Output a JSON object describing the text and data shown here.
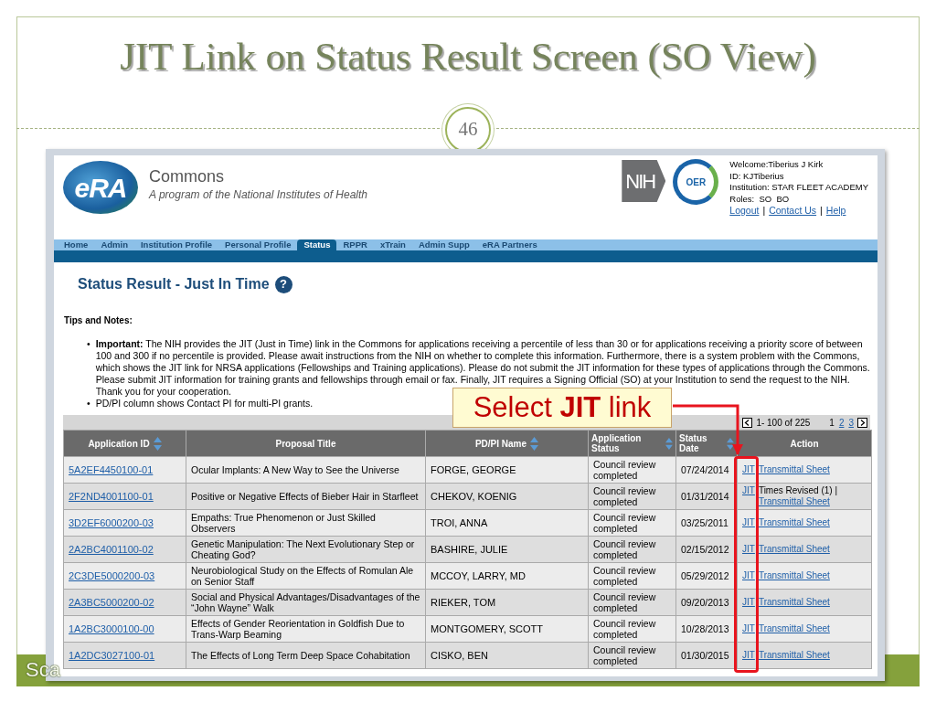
{
  "slide": {
    "title": "JIT Link on Status Result Screen (SO View)",
    "page_number": "46",
    "footer_text": "Sca"
  },
  "screen": {
    "header": {
      "logo_mark": "eRA",
      "logo_title": "Commons",
      "logo_subtitle": "A program of the National Institutes of Health",
      "agency_logo": "NIH",
      "office_logo": "OER",
      "user_info": [
        "Welcome:Tiberius J Kirk",
        "ID: KJTiberius",
        "Institution: STAR FLEET ACADEMY",
        "Roles:  SO  BO"
      ],
      "links": [
        "Logout",
        "Contact Us",
        "Help"
      ],
      "separator": "|"
    },
    "nav": [
      {
        "label": "Home",
        "selected": false
      },
      {
        "label": "Admin",
        "selected": false
      },
      {
        "label": "Institution Profile",
        "selected": false
      },
      {
        "label": "Personal Profile",
        "selected": false
      },
      {
        "label": "Status",
        "selected": true
      },
      {
        "label": "RPPR",
        "selected": false
      },
      {
        "label": "xTrain",
        "selected": false
      },
      {
        "label": "Admin Supp",
        "selected": false
      },
      {
        "label": "eRA Partners",
        "selected": false
      }
    ],
    "page_title": "Status Result - Just In Time",
    "help_mark": "?",
    "tips_heading": "Tips and Notes:",
    "tips": [
      {
        "bullet": "•",
        "text": "**Important:**  The NIH provides the JIT (Just in Time) link in the Commons for applications receiving a percentile of less than 30 or for applications receiving a priority score of between 100 and 300 if no percentile is provided.  Please await instructions from the NIH on whether to complete this information.  Furthermore, there is a system problem with the Commons, which shows the JIT link for NRSA applications (Fellowships and Training applications).  Please do not submit the JIT information for these types of applications through the Commons. Please submit JIT information for training grants and fellowships through email or fax.  Finally, JIT requires a Signing Official (SO) at your Institution to send the request to the NIH.  Thank you for your cooperation."
      },
      {
        "bullet": "•",
        "text": "PD/PI column shows Contact PI for multi-PI grants."
      }
    ],
    "pager": {
      "range": "1- 100 of 225",
      "pages": [
        {
          "label": "1",
          "selected": true
        },
        {
          "label": "2",
          "selected": false
        },
        {
          "label": "3",
          "selected": false
        }
      ]
    },
    "table": {
      "columns": [
        {
          "label": "Application ID",
          "sortable": true
        },
        {
          "label": "Proposal Title",
          "sortable": false
        },
        {
          "label": "PD/PI Name",
          "sortable": true
        },
        {
          "label": "Application Status",
          "sortable": true
        },
        {
          "label": "Status Date",
          "sortable": true
        },
        {
          "label": "Action",
          "sortable": false
        }
      ],
      "rows": [
        {
          "application_id": "5A2EF4450100-01",
          "title": "Ocular Implants: A New Way to See the Universe",
          "pd_pi_name": "FORGE, GEORGE",
          "status": "Council review completed",
          "status_date": "07/24/2014",
          "jit": "JIT",
          "transmittal": "Transmittal Sheet"
        },
        {
          "application_id": "2F2ND4001100-01",
          "title": "Positive or Negative Effects of Bieber Hair in Starfleet",
          "pd_pi_name": "CHEKOV, KOENIG",
          "status": "Council review completed",
          "status_date": "01/31/2014",
          "jit": "JIT",
          "note": "Times Revised (1) |",
          "transmittal": "Transmittal Sheet"
        },
        {
          "application_id": "3D2EF6000200-03",
          "title": "Empaths: True Phenomenon or Just Skilled Observers",
          "pd_pi_name": "TROI, ANNA",
          "status": "Council review completed",
          "status_date": "03/25/2011",
          "jit": "JIT",
          "transmittal": "Transmittal Sheet"
        },
        {
          "application_id": "2A2BC4001100-02",
          "title": "Genetic Manipulation: The Next Evolutionary Step or Cheating God?",
          "pd_pi_name": "BASHIRE, JULIE",
          "status": "Council review completed",
          "status_date": "02/15/2012",
          "jit": "JIT",
          "transmittal": "Transmittal Sheet"
        },
        {
          "application_id": "2C3DE5000200-03",
          "title": "Neurobiological Study on the Effects of Romulan Ale on Senior Staff",
          "pd_pi_name": "MCCOY, LARRY, MD",
          "status": "Council review completed",
          "status_date": "05/29/2012",
          "jit": "JIT",
          "transmittal": "Transmittal Sheet"
        },
        {
          "application_id": "2A3BC5000200-02",
          "title": "Social and Physical Advantages/Disadvantages of the “John Wayne” Walk",
          "pd_pi_name": "RIEKER, TOM",
          "status": "Council review completed",
          "status_date": "09/20/2013",
          "jit": "JIT",
          "transmittal": "Transmittal Sheet"
        },
        {
          "application_id": "1A2BC3000100-00",
          "title": "Effects of Gender Reorientation in Goldfish Due to Trans-Warp Beaming",
          "pd_pi_name": "MONTGOMERY, SCOTT",
          "status": "Council review completed",
          "status_date": "10/28/2013",
          "jit": "JIT",
          "transmittal": "Transmittal Sheet"
        },
        {
          "application_id": "1A2DC3027100-01",
          "title": "The Effects of Long Term Deep Space Cohabitation",
          "pd_pi_name": "CISKO, BEN",
          "status": "Council review completed",
          "status_date": "01/30/2015",
          "jit": "JIT",
          "transmittal": "Transmittal Sheet"
        }
      ]
    }
  },
  "callout": {
    "text": "Select **JIT** link"
  }
}
